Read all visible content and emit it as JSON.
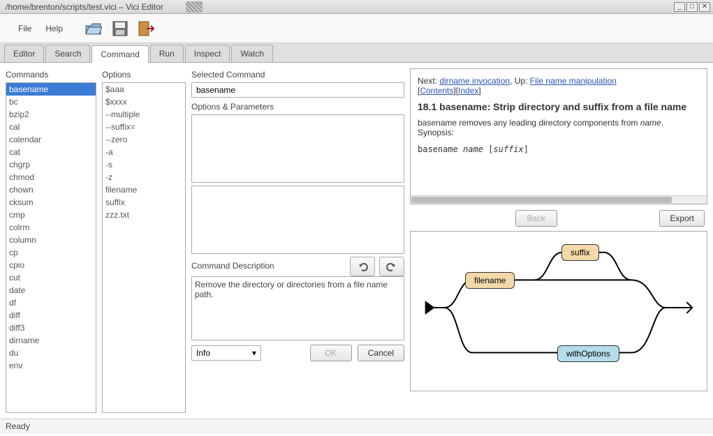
{
  "window": {
    "title": "/home/brenton/scripts/test.vici – Vici Editor"
  },
  "menu": {
    "file": "File",
    "help": "Help"
  },
  "icons": {
    "tool1": "open-icon",
    "tool2": "save-icon",
    "tool3": "exit-icon"
  },
  "tabs": [
    "Editor",
    "Search",
    "Command",
    "Run",
    "Inspect",
    "Watch"
  ],
  "tabs_active": 2,
  "labels": {
    "commands": "Commands",
    "options": "Options",
    "selected": "Selected Command",
    "opsparams": "Options & Parameters",
    "cmddesc": "Command Description"
  },
  "commands": [
    "basename",
    "bc",
    "bzip2",
    "cal",
    "calendar",
    "cat",
    "chgrp",
    "chmod",
    "chown",
    "cksum",
    "cmp",
    "colrm",
    "column",
    "cp",
    "cpio",
    "cut",
    "date",
    "df",
    "diff",
    "diff3",
    "dirname",
    "du",
    "env"
  ],
  "commands_sel": 0,
  "options": [
    "$aaa",
    "$xxxx",
    "--multiple",
    "--suffix=",
    "--zero",
    "-a",
    "-s",
    "-z",
    "filename",
    "suffix",
    "zzz.txt"
  ],
  "selected_command": "basename",
  "ops_params": "",
  "cmd_description": "Remove the directory or directories from a file name path.",
  "info_select": "Info",
  "buttons": {
    "ok": "OK",
    "cancel": "Cancel",
    "back": "Back",
    "export": "Export"
  },
  "doc": {
    "nav_next": "Next: ",
    "link1": "dirname invocation",
    "nav_up": ", Up: ",
    "link2": "File name manipulation",
    "link3": "Contents",
    "link4": "Index",
    "heading": "18.1 basename: Strip directory and suffix from a file name",
    "body1": "basename removes any leading directory components from ",
    "body1i": "name",
    "body1b": ". Synopsis:",
    "syn": "basename ",
    "syn_i1": "name",
    "syn2": " [",
    "syn_i2": "suffix",
    "syn3": "]"
  },
  "diagram": {
    "n1": "filename",
    "n2": "suffix",
    "n3": "withOptions"
  },
  "status": "Ready"
}
